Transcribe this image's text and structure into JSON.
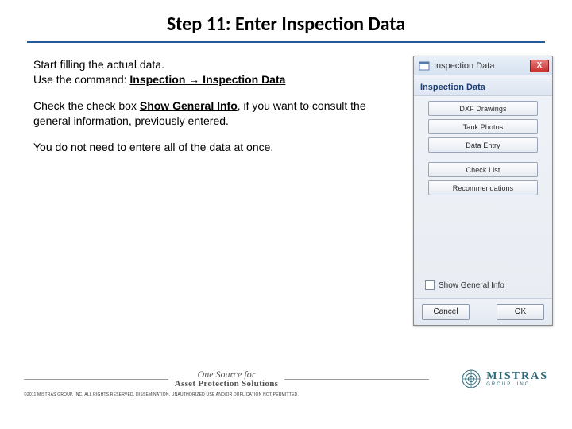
{
  "title": "Step 11: Enter Inspection Data",
  "body": {
    "p1a": "Start filling the actual data.",
    "p1b": "Use the command: ",
    "cmd": "Inspection → Inspection Data",
    "p2a": "Check the check box ",
    "p2b": "Show General Info",
    "p2c": ", if you want to consult the general information, previously entered.",
    "p3": "You do not need to entere all of the data at once."
  },
  "dialog": {
    "title": "Inspection Data",
    "section": "Inspection Data",
    "buttons": [
      "DXF Drawings",
      "Tank Photos",
      "Data Entry",
      "Check List",
      "Recommendations"
    ],
    "showGeneral": "Show General Info",
    "cancel": "Cancel",
    "ok": "OK",
    "close": "X"
  },
  "footer": {
    "sloganLine1": "One Source for",
    "sloganLine2": "Asset Protection Solutions",
    "logoName": "MISTRAS",
    "logoSub": "GROUP, INC.",
    "copyright": "©2011 MISTRAS GROUP, INC. ALL RIGHTS RESERVED. DISSEMINATION, UNAUTHORIZED USE AND/OR DUPLICATION NOT PERMITTED."
  }
}
